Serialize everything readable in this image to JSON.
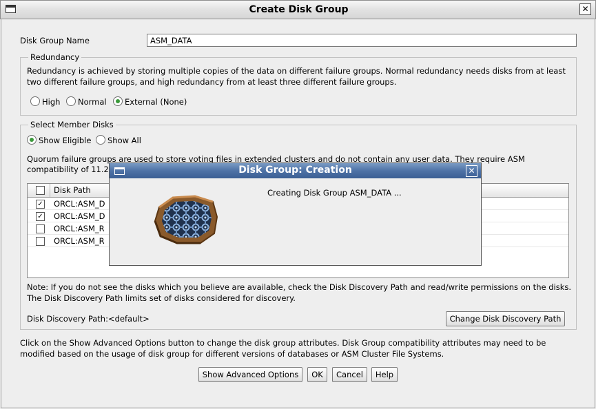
{
  "window": {
    "title": "Create Disk Group",
    "close_symbol": "✕"
  },
  "disk_group_name": {
    "label": "Disk Group Name",
    "value": "ASM_DATA"
  },
  "redundancy": {
    "legend": "Redundancy",
    "description_line1": "Redundancy is achieved by storing multiple copies of the data on different failure groups. Normal redundancy needs disks from at least",
    "description_line2": "two different failure groups, and high redundancy from at least three different failure groups.",
    "options": [
      {
        "label": "High",
        "selected": false
      },
      {
        "label": "Normal",
        "selected": false
      },
      {
        "label": "External (None)",
        "selected": true
      }
    ]
  },
  "member_disks": {
    "legend": "Select Member Disks",
    "filter_options": [
      {
        "label": "Show Eligible",
        "selected": true
      },
      {
        "label": "Show All",
        "selected": false
      }
    ],
    "quorum_line1": "Quorum failure groups are used to store voting files in extended clusters and do not contain any user data. They require ASM",
    "quorum_line2": "compatibility of 11.2",
    "table": {
      "column_header": "Disk Path",
      "rows": [
        {
          "checked": true,
          "path": "ORCL:ASM_D"
        },
        {
          "checked": true,
          "path": "ORCL:ASM_D"
        },
        {
          "checked": false,
          "path": "ORCL:ASM_R"
        },
        {
          "checked": false,
          "path": "ORCL:ASM_R"
        }
      ]
    },
    "note_line1": "Note: If you do not see the disks which you believe are available, check the Disk Discovery Path and read/write permissions on the disks.",
    "note_line2": "The Disk Discovery Path limits set of disks considered for discovery.",
    "discovery_path_label": "Disk Discovery Path:<default>",
    "change_path_button": "Change Disk Discovery Path"
  },
  "advanced_note_line1": "Click on the Show Advanced Options button to change the disk group attributes. Disk Group compatibility attributes may need to be",
  "advanced_note_line2": "modified based on the usage of disk group for different versions of databases or ASM Cluster File Systems.",
  "buttons": {
    "advanced": "Show Advanced Options",
    "ok": "OK",
    "cancel": "Cancel",
    "help": "Help"
  },
  "modal": {
    "title": "Disk Group: Creation",
    "close_symbol": "✕",
    "message": "Creating Disk Group ASM_DATA ...",
    "icon": "disk-gears-icon"
  },
  "colors": {
    "modal_title_bar": "#4e72a6",
    "radio_selected": "#3a9a3a"
  }
}
